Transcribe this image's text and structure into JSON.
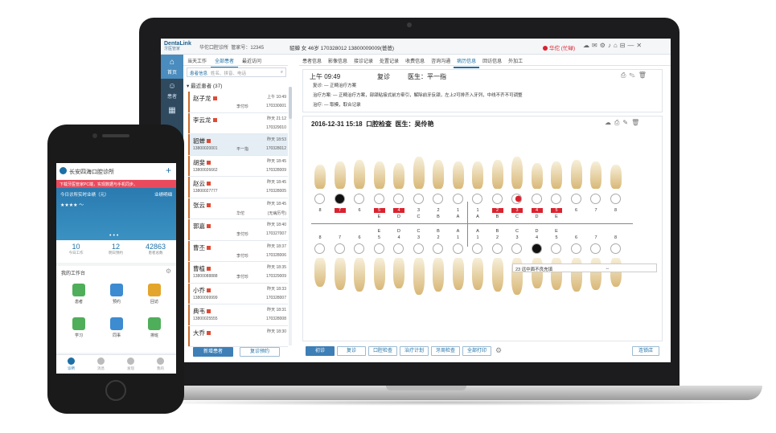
{
  "app": {
    "logo": "DentaLink",
    "logo_sub": "牙医管家",
    "clinic": "华佗口腔诊所",
    "manager_no": "管家号：12345",
    "patient_header": "貂蝉 女 46岁 170328012 13800009009(爸爸)",
    "status": "华佗 (忙碌)"
  },
  "sidenav": [
    {
      "icon": "home-icon",
      "label": "首页",
      "active": true
    },
    {
      "icon": "patient-icon",
      "label": "患者",
      "active": false
    },
    {
      "icon": "calendar-icon",
      "label": "",
      "active": false
    }
  ],
  "list_tabs": [
    {
      "label": "当天工作",
      "active": false
    },
    {
      "label": "全部患者",
      "active": true
    },
    {
      "label": "最近访问",
      "active": false
    }
  ],
  "record_tabs": [
    {
      "label": "患者信息",
      "active": false
    },
    {
      "label": "影像信息",
      "active": false
    },
    {
      "label": "接诊记录",
      "active": false
    },
    {
      "label": "处置记录",
      "active": false
    },
    {
      "label": "收费信息",
      "active": false
    },
    {
      "label": "咨询沟通",
      "active": false
    },
    {
      "label": "病历信息",
      "active": true
    },
    {
      "label": "回访信息",
      "active": false
    },
    {
      "label": "外加工",
      "active": false
    }
  ],
  "search": {
    "scope": "患者信息",
    "placeholder": "姓名、拼音、电话"
  },
  "list_header": "最近患者 (37)",
  "patients": [
    {
      "name": "赵子龙",
      "date": "上午 10:49",
      "phone": "",
      "doctor": "李付珍",
      "id": "170330001",
      "selected": false
    },
    {
      "name": "李云龙",
      "date": "昨天 21:12",
      "phone": "",
      "doctor": "",
      "id": "170329010",
      "selected": false
    },
    {
      "name": "貂蝉",
      "date": "昨天 18:53",
      "phone": "13800020001",
      "doctor": "平一指",
      "id": "170328012",
      "selected": true
    },
    {
      "name": "胡斐",
      "date": "昨天 18:45",
      "phone": "13800026662",
      "doctor": "",
      "id": "170328009",
      "selected": false
    },
    {
      "name": "赵云",
      "date": "昨天 18:45",
      "phone": "13800027777",
      "doctor": "",
      "id": "170328005",
      "selected": false
    },
    {
      "name": "张云",
      "date": "昨天 18:45",
      "phone": "",
      "doctor": "华佗",
      "id": "(无病历号)",
      "selected": false
    },
    {
      "name": "郭嘉",
      "date": "昨天 18:40",
      "phone": "",
      "doctor": "李付珍",
      "id": "170327007",
      "selected": false
    },
    {
      "name": "曹丕",
      "date": "昨天 18:37",
      "phone": "",
      "doctor": "李付珍",
      "id": "170328006",
      "selected": false
    },
    {
      "name": "曹植",
      "date": "昨天 18:35",
      "phone": "13800088888",
      "doctor": "李付珍",
      "id": "170329009",
      "selected": false
    },
    {
      "name": "小乔",
      "date": "昨天 18:33",
      "phone": "13800099999",
      "doctor": "",
      "id": "170328007",
      "selected": false
    },
    {
      "name": "典韦",
      "date": "昨天 18:31",
      "phone": "13800025555",
      "doctor": "",
      "id": "170328008",
      "selected": false
    },
    {
      "name": "大乔",
      "date": "昨天 18:30",
      "phone": "",
      "doctor": "",
      "id": "",
      "selected": false
    }
  ],
  "list_buttons": {
    "new": "新增患者",
    "revisit": "复诊预约"
  },
  "record1": {
    "time": "上午 09:49",
    "type": "复诊",
    "doctor": "医生：平一指",
    "lines": [
      {
        "label": "复诊:",
        "text": "正畸治疗方案"
      },
      {
        "label": "治疗方案:",
        "text": "正畸治疗方案，部颌粘接式前方牵引，解除前牙反颌，左上2可排齐入牙列，中线不齐不可调整"
      },
      {
        "label": "治疗:",
        "text": "取模，取合记录"
      }
    ]
  },
  "record2": {
    "date": "2016-12-31 15:18",
    "type": "口腔检查",
    "doctor": "医生：吴伶艳",
    "upper_nums": [
      "8",
      "7",
      "6",
      "5",
      "4",
      "3",
      "2",
      "1",
      "1",
      "2",
      "3",
      "4",
      "5",
      "6",
      "7",
      "8"
    ],
    "upper_red": [
      1,
      3,
      4,
      9,
      10,
      11,
      12
    ],
    "upper_letters": [
      "",
      "",
      "",
      "E",
      "D",
      "C",
      "B",
      "A",
      "A",
      "B",
      "C",
      "D",
      "E",
      "",
      "",
      ""
    ],
    "lower_letters": [
      "",
      "",
      "",
      "E",
      "D",
      "C",
      "B",
      "A",
      "A",
      "B",
      "C",
      "D",
      "E",
      "",
      "",
      ""
    ],
    "lower_nums": [
      "8",
      "7",
      "6",
      "5",
      "4",
      "3",
      "2",
      "1",
      "1",
      "2",
      "3",
      "4",
      "5",
      "6",
      "7",
      "8"
    ],
    "note": "23 远中面不良充填",
    "note_mark": "↔"
  },
  "bottom_buttons": [
    "初诊",
    "复诊",
    "口腔检查",
    "治疗计划",
    "牙周检查",
    "全部打印"
  ],
  "bottom_right": "连锁店",
  "mobile": {
    "clinic": "长安四海口腔诊所",
    "alert": "下载牙医管家PC端，实现数据与手机同步。",
    "banner_left": "今日诊所实时业绩（元）",
    "banner_right": "业绩明细",
    "banner_value": "★★★★ ～",
    "stats": [
      {
        "n": "10",
        "l": "今日工作"
      },
      {
        "n": "12",
        "l": "明日预约"
      },
      {
        "n": "42863",
        "l": "患者总数"
      }
    ],
    "work_title": "我的工作台",
    "apps": [
      {
        "label": "患者",
        "color": "#4fae5a"
      },
      {
        "label": "预约",
        "color": "#3d8bd1"
      },
      {
        "label": "回访",
        "color": "#e3a52b"
      },
      {
        "label": "学习",
        "color": "#4fae5a"
      },
      {
        "label": "同事",
        "color": "#3d8bd1"
      },
      {
        "label": "排班",
        "color": "#4fae5a"
      }
    ],
    "tabs": [
      {
        "label": "诊所",
        "on": true
      },
      {
        "label": "消息",
        "on": false
      },
      {
        "label": "发现",
        "on": false
      },
      {
        "label": "我的",
        "on": false
      }
    ]
  }
}
